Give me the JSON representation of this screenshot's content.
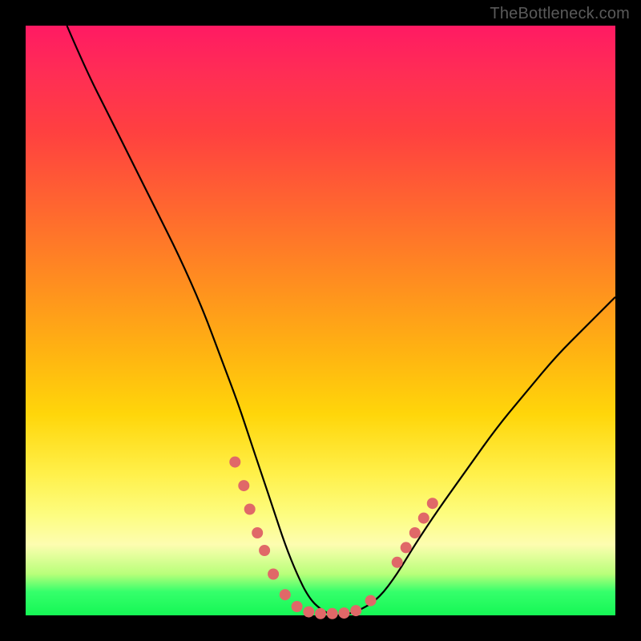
{
  "watermark": "TheBottleneck.com",
  "colors": {
    "frame": "#000000",
    "curve_stroke": "#000000",
    "marker_fill": "#e06868",
    "gradient_top": "#ff1a63",
    "gradient_bottom": "#15f755"
  },
  "chart_data": {
    "type": "line",
    "title": "",
    "xlabel": "",
    "ylabel": "",
    "xlim": [
      0,
      100
    ],
    "ylim": [
      0,
      100
    ],
    "grid": false,
    "legend": false,
    "series": [
      {
        "name": "bottleneck-curve",
        "x": [
          7,
          10,
          14,
          18,
          22,
          26,
          30,
          33,
          36,
          38,
          40,
          42,
          44,
          46,
          48,
          50,
          52,
          54,
          57,
          60,
          63,
          66,
          70,
          75,
          80,
          85,
          90,
          95,
          100
        ],
        "y": [
          100,
          93,
          85,
          77,
          69,
          61,
          52,
          44,
          36,
          30,
          24,
          18,
          12,
          7,
          3,
          1,
          0,
          0,
          1,
          3,
          7,
          12,
          18,
          25,
          32,
          38,
          44,
          49,
          54
        ]
      }
    ],
    "markers": [
      {
        "x": 35.5,
        "y": 26
      },
      {
        "x": 37.0,
        "y": 22
      },
      {
        "x": 38.0,
        "y": 18
      },
      {
        "x": 39.3,
        "y": 14
      },
      {
        "x": 40.5,
        "y": 11
      },
      {
        "x": 42.0,
        "y": 7
      },
      {
        "x": 44.0,
        "y": 3.5
      },
      {
        "x": 46.0,
        "y": 1.5
      },
      {
        "x": 48.0,
        "y": 0.6
      },
      {
        "x": 50.0,
        "y": 0.3
      },
      {
        "x": 52.0,
        "y": 0.3
      },
      {
        "x": 54.0,
        "y": 0.4
      },
      {
        "x": 56.0,
        "y": 0.8
      },
      {
        "x": 58.5,
        "y": 2.5
      },
      {
        "x": 63.0,
        "y": 9
      },
      {
        "x": 64.5,
        "y": 11.5
      },
      {
        "x": 66.0,
        "y": 14
      },
      {
        "x": 67.5,
        "y": 16.5
      },
      {
        "x": 69.0,
        "y": 19
      }
    ]
  }
}
